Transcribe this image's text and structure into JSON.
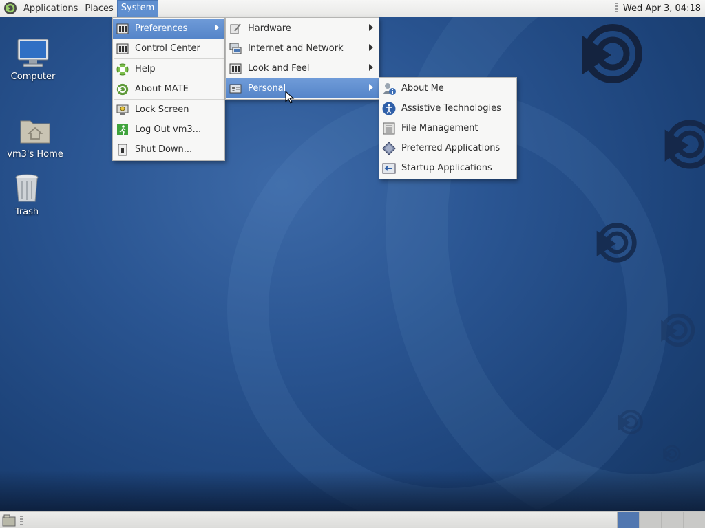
{
  "top_panel": {
    "applications_label": "Applications",
    "places_label": "Places",
    "system_label": "System",
    "clock": "Wed Apr 3, 04:18"
  },
  "desktop": {
    "icons": [
      {
        "label": "Computer",
        "icon": "computer-icon"
      },
      {
        "label": "vm3's Home",
        "icon": "home-folder-icon"
      },
      {
        "label": "Trash",
        "icon": "trash-icon"
      }
    ]
  },
  "system_menu": {
    "items": [
      {
        "label": "Preferences",
        "icon": "preferences-icon",
        "submenu": true,
        "active": true
      },
      {
        "label": "Control Center",
        "icon": "control-center-icon"
      },
      {
        "label": "Help",
        "icon": "help-icon"
      },
      {
        "label": "About MATE",
        "icon": "mate-logo-icon"
      },
      {
        "label": "Lock Screen",
        "icon": "lock-screen-icon"
      },
      {
        "label": "Log Out vm3...",
        "icon": "log-out-icon"
      },
      {
        "label": "Shut Down...",
        "icon": "shut-down-icon"
      }
    ]
  },
  "preferences_menu": {
    "items": [
      {
        "label": "Hardware",
        "icon": "hardware-icon",
        "submenu": true
      },
      {
        "label": "Internet and Network",
        "icon": "network-icon",
        "submenu": true
      },
      {
        "label": "Look and Feel",
        "icon": "look-and-feel-icon",
        "submenu": true
      },
      {
        "label": "Personal",
        "icon": "personal-icon",
        "submenu": true,
        "active": true
      }
    ]
  },
  "personal_menu": {
    "items": [
      {
        "label": "About Me",
        "icon": "about-me-icon"
      },
      {
        "label": "Assistive Technologies",
        "icon": "accessibility-icon"
      },
      {
        "label": "File Management",
        "icon": "file-management-icon"
      },
      {
        "label": "Preferred Applications",
        "icon": "preferred-applications-icon"
      },
      {
        "label": "Startup Applications",
        "icon": "startup-applications-icon"
      }
    ]
  },
  "colors": {
    "menu_highlight": "#5f8fd0",
    "desktop_blue": "#2a5592",
    "active_workspace": "#5177b0"
  }
}
